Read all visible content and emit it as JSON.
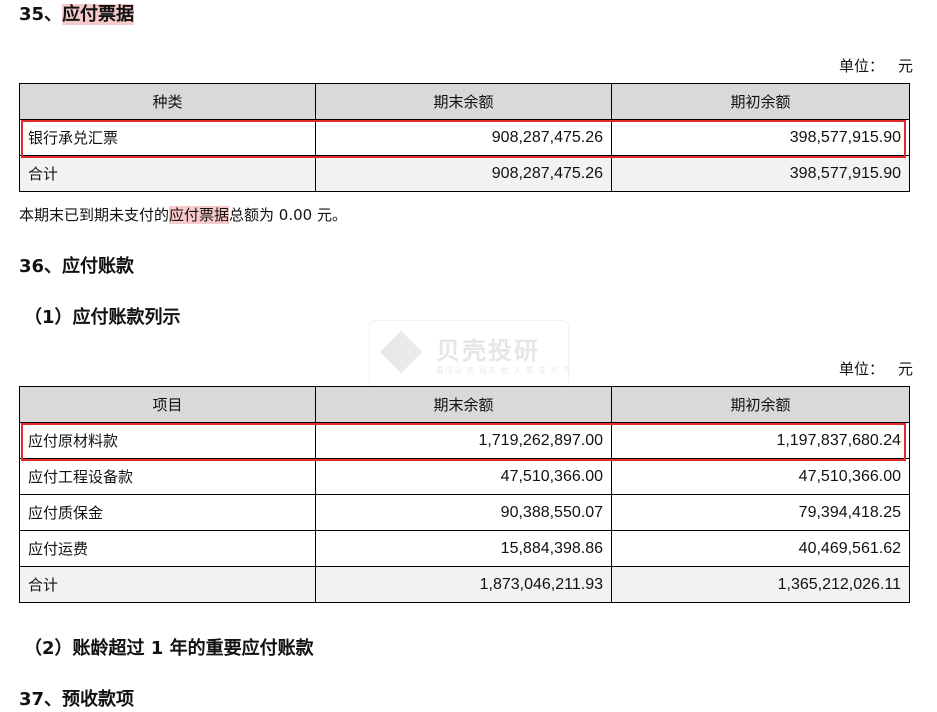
{
  "sec35": {
    "title_prefix": "35、",
    "title_main": "应付票据",
    "unit_label": "单位：",
    "unit_value": "元",
    "headers": [
      "种类",
      "期末余额",
      "期初余额"
    ],
    "rows": [
      {
        "name": "银行承兑汇票",
        "end": "908,287,475.26",
        "begin": "398,577,915.90"
      }
    ],
    "total": {
      "name": "合计",
      "end": "908,287,475.26",
      "begin": "398,577,915.90"
    },
    "note_pre": "本期末已到期未支付的",
    "note_hl": "应付票据",
    "note_post": "总额为 0.00 元。"
  },
  "sec36": {
    "title": "36、应付账款",
    "sub1": "（1）应付账款列示",
    "unit_label": "单位：",
    "unit_value": "元",
    "headers": [
      "项目",
      "期末余额",
      "期初余额"
    ],
    "rows": [
      {
        "name": "应付原材料款",
        "end": "1,719,262,897.00",
        "begin": "1,197,837,680.24"
      },
      {
        "name": "应付工程设备款",
        "end": "47,510,366.00",
        "begin": "47,510,366.00"
      },
      {
        "name": "应付质保金",
        "end": "90,388,550.07",
        "begin": "79,394,418.25"
      },
      {
        "name": "应付运费",
        "end": "15,884,398.86",
        "begin": "40,469,561.62"
      }
    ],
    "total": {
      "name": "合计",
      "end": "1,873,046,211.93",
      "begin": "1,365,212,026.11"
    },
    "sub2": "（2）账龄超过 1 年的重要应付账款"
  },
  "sec37": {
    "title": "37、预收款项"
  },
  "watermark": {
    "brand": "贝壳投研",
    "slogan": "看得见 值 投资 助 入 都 在 贝 壳"
  },
  "colors": {
    "highlight_box": "#e52a2a",
    "text_highlight": "#f6caca",
    "header_fill": "#d9d9d9"
  }
}
